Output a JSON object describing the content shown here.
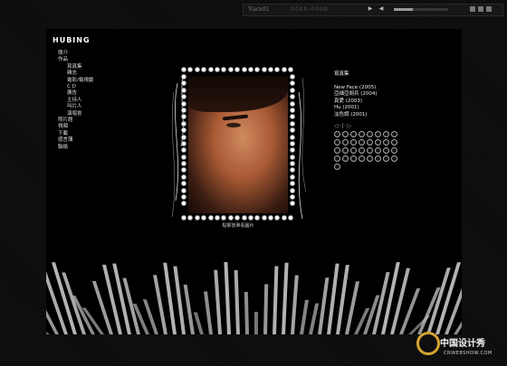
{
  "player": {
    "track": "Track01",
    "code": "0000-0000",
    "progress": 0.35,
    "controls": [
      "play-icon",
      "prev-icon",
      "next-icon",
      "stop-icon"
    ]
  },
  "site": {
    "logo": "HUBING"
  },
  "nav": {
    "items": [
      {
        "label": "簡介",
        "level": 0
      },
      {
        "label": "作品",
        "level": 0
      },
      {
        "label": "寫真集",
        "level": 1
      },
      {
        "label": "雜志",
        "level": 1
      },
      {
        "label": "電影/電視劇",
        "level": 1
      },
      {
        "label": "C D",
        "level": 1
      },
      {
        "label": "廣告",
        "level": 1
      },
      {
        "label": "主持人",
        "level": 1
      },
      {
        "label": "叫片人",
        "level": 1
      },
      {
        "label": "演唱會",
        "level": 1
      },
      {
        "label": "照片館",
        "level": 0
      },
      {
        "label": "視頻",
        "level": 0
      },
      {
        "label": "下載",
        "level": 0
      },
      {
        "label": "感言薄",
        "level": 0
      },
      {
        "label": "聯絡",
        "level": 0
      }
    ]
  },
  "photo": {
    "caption": "點擊放單看圖片"
  },
  "info": {
    "title": "寫真集",
    "albums": [
      "New Face (2005)",
      "亞細亞胡兵 (2004)",
      "真愛 (2003)",
      "Hu (2001)",
      "淡色調 (2001)"
    ],
    "mini_player": "◁·|·▷",
    "track_count": 33
  },
  "watermark": {
    "text": "中国设计秀",
    "url": "CNWEBSHOW.COM"
  }
}
